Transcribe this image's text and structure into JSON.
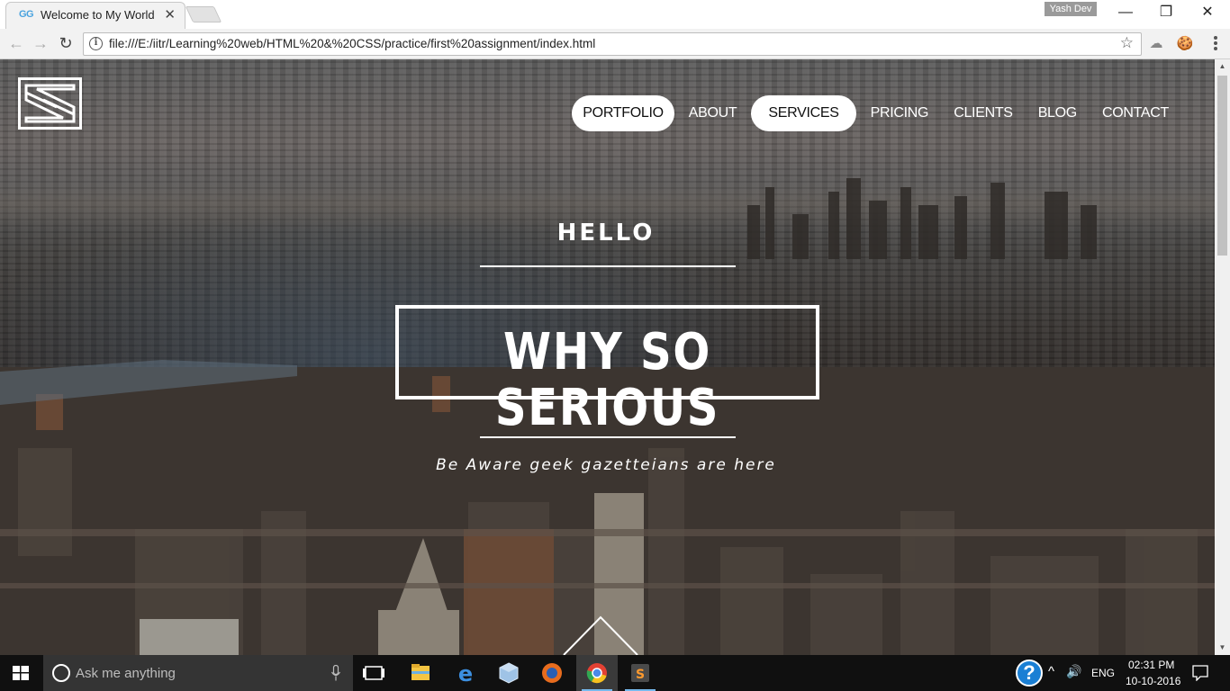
{
  "browser": {
    "tab_favicon": "GG",
    "tab_title": "Welcome to My World",
    "tab_close": "✕",
    "profile_name": "Yash Dev",
    "window_controls": {
      "minimize": "—",
      "maximize": "❐",
      "close": "✕"
    },
    "back": "←",
    "forward": "→",
    "reload": "↻",
    "info_icon": "i",
    "url": "file:///E:/iitr/Learning%20web/HTML%20&%20CSS/practice/first%20assignment/index.html",
    "bookmark_star": "☆",
    "extensions": [
      "☁",
      "🍪"
    ]
  },
  "site": {
    "nav": [
      {
        "label": "PORTFOLIO",
        "active": true
      },
      {
        "label": "ABOUT",
        "active": false
      },
      {
        "label": "SERVICES",
        "active": true
      },
      {
        "label": "PRICING",
        "active": false
      },
      {
        "label": "CLIENTS",
        "active": false
      },
      {
        "label": "BLOG",
        "active": false
      },
      {
        "label": "CONTACT",
        "active": false
      }
    ],
    "hello": "HELLO",
    "title": "WHY SO SERIOUS",
    "tagline": "Be Aware geek gazetteians are here",
    "scroll_up": "▲",
    "scroll_down": "▼"
  },
  "taskbar": {
    "search_placeholder": "Ask me anything",
    "help": "?",
    "tray_caret": "^",
    "volume": "🔊",
    "language": "ENG",
    "time": "02:31 PM",
    "date": "10-10-2016"
  },
  "colors": {
    "tab_bg": "#f2f2f2",
    "toolbar_bg": "#f2f2f2",
    "nav_active_bg": "#ffffff",
    "taskbar_bg": "#101010",
    "accent": "#76b9ed"
  }
}
